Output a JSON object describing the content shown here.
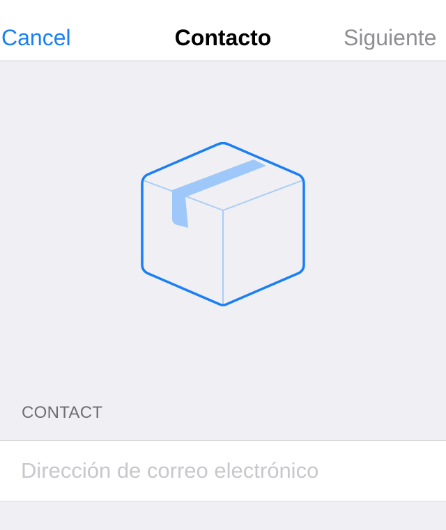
{
  "navbar": {
    "cancel_label": "Cancel",
    "title": "Contacto",
    "next_label": "Siguiente"
  },
  "hero": {
    "icon": "package-box-icon",
    "colors": {
      "outline": "#1a7ff5",
      "inner_lines": "#a9cdf7",
      "tape": "#9ec8f9"
    }
  },
  "contact_section": {
    "header": "CONTACT",
    "email_field": {
      "value": "",
      "placeholder": "Dirección de correo electrónico"
    }
  },
  "colors": {
    "accent": "#1a7ff5",
    "disabled": "#8e8e93",
    "background": "#efeff4"
  }
}
